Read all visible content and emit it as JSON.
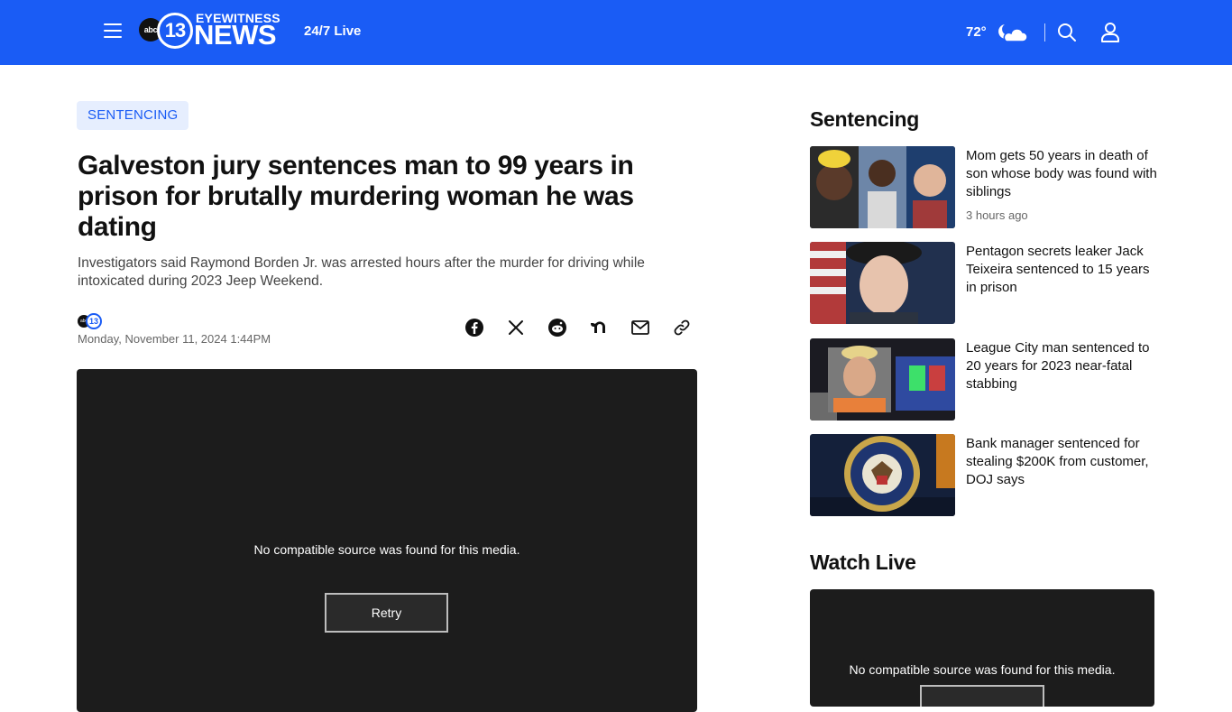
{
  "header": {
    "brand_network": "abc",
    "brand_channel": "13",
    "brand_top": "EYEWITNESS",
    "brand_main": "NEWS",
    "live_label": "24/7 Live",
    "temperature": "72°",
    "weather_icon": "partly-cloudy-night-icon",
    "colors": {
      "bar": "#1a5cf5",
      "text": "#ffffff"
    }
  },
  "article": {
    "tag": "SENTENCING",
    "headline": "Galveston jury sentences man to 99 years in prison for brutally murdering woman he was dating",
    "dek": "Investigators said Raymond Borden Jr. was arrested hours after the murder for driving while intoxicated during 2023 Jeep Weekend.",
    "source_logo": {
      "network": "abc",
      "channel": "13"
    },
    "date": "Monday, November 11, 2024 1:44PM",
    "share_icons": [
      "facebook-icon",
      "x-icon",
      "reddit-icon",
      "nextdoor-icon",
      "email-icon",
      "link-icon"
    ],
    "player": {
      "message": "No compatible source was found for this media.",
      "retry_label": "Retry"
    }
  },
  "sidebar": {
    "section_title": "Sentencing",
    "stories": [
      {
        "title": "Mom gets 50 years in death of son whose body was found with siblings",
        "time": "3 hours ago"
      },
      {
        "title": "Pentagon secrets leaker Jack Teixeira sentenced to 15 years in prison",
        "time": ""
      },
      {
        "title": "League City man sentenced to 20 years for 2023 near-fatal stabbing",
        "time": ""
      },
      {
        "title": "Bank manager sentenced for stealing $200K from customer, DOJ says",
        "time": ""
      }
    ],
    "watch_title": "Watch Live",
    "watch_player": {
      "message": "No compatible source was found for this media."
    }
  }
}
